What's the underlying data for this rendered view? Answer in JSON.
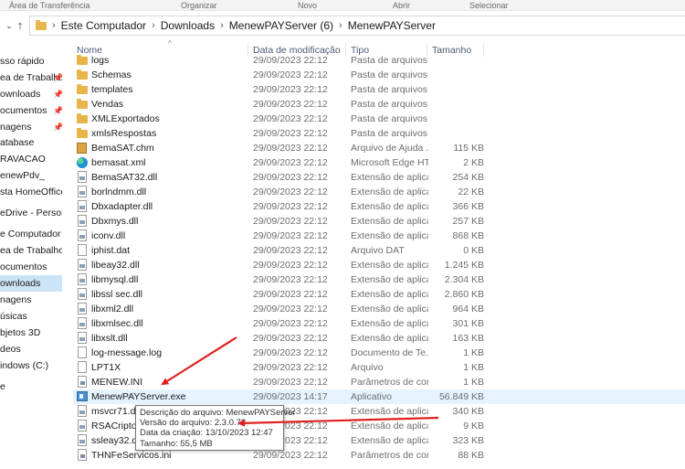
{
  "ribbon": {
    "groups": [
      "Área de Transferência",
      "Organizar",
      "Novo",
      "Abrir",
      "Selecionar"
    ]
  },
  "address": {
    "crumbs": [
      "Este Computador",
      "Downloads",
      "MenewPAYServer (6)",
      "MenewPAYServer"
    ]
  },
  "sidebar": {
    "items": [
      {
        "label": "sso rápido",
        "pinned": false
      },
      {
        "label": "ea de Trabalho",
        "pinned": true
      },
      {
        "label": "ownloads",
        "pinned": true
      },
      {
        "label": "ocumentos",
        "pinned": true
      },
      {
        "label": "nagens",
        "pinned": true
      },
      {
        "label": "atabase",
        "pinned": false
      },
      {
        "label": "RAVACAO",
        "pinned": false
      },
      {
        "label": "enewPdv_",
        "pinned": false
      },
      {
        "label": "sta HomeOffice",
        "pinned": false
      },
      {
        "label": "eDrive - Personal",
        "pinned": false
      },
      {
        "label": "e Computador",
        "pinned": false
      },
      {
        "label": "ea de Trabalho",
        "pinned": false
      },
      {
        "label": "ocumentos",
        "pinned": false
      },
      {
        "label": "ownloads",
        "pinned": false,
        "active": true
      },
      {
        "label": "nagens",
        "pinned": false
      },
      {
        "label": "úsicas",
        "pinned": false
      },
      {
        "label": "bjetos 3D",
        "pinned": false
      },
      {
        "label": "deos",
        "pinned": false
      },
      {
        "label": "indows (C:)",
        "pinned": false
      },
      {
        "label": "e",
        "pinned": false
      }
    ]
  },
  "columns": {
    "name": "Nome",
    "date": "Data de modificação",
    "type": "Tipo",
    "size": "Tamanho"
  },
  "files": [
    {
      "name": "logs",
      "date": "29/09/2023 22:12",
      "type": "Pasta de arquivos",
      "size": "",
      "icon": "folder-icon"
    },
    {
      "name": "Schemas",
      "date": "29/09/2023 22:12",
      "type": "Pasta de arquivos",
      "size": "",
      "icon": "folder-icon"
    },
    {
      "name": "templates",
      "date": "29/09/2023 22:12",
      "type": "Pasta de arquivos",
      "size": "",
      "icon": "folder-icon"
    },
    {
      "name": "Vendas",
      "date": "29/09/2023 22:12",
      "type": "Pasta de arquivos",
      "size": "",
      "icon": "folder-icon"
    },
    {
      "name": "XMLExportados",
      "date": "29/09/2023 22:12",
      "type": "Pasta de arquivos",
      "size": "",
      "icon": "folder-icon"
    },
    {
      "name": "xmlsRespostas",
      "date": "29/09/2023 22:12",
      "type": "Pasta de arquivos",
      "size": "",
      "icon": "folder-icon"
    },
    {
      "name": "BemaSAT.chm",
      "date": "29/09/2023 22:12",
      "type": "Arquivo de Ajuda ...",
      "size": "115 KB",
      "icon": "chm-icon"
    },
    {
      "name": "bemasat.xml",
      "date": "29/09/2023 22:12",
      "type": "Microsoft Edge HT...",
      "size": "2 KB",
      "icon": "edge-icon"
    },
    {
      "name": "BemaSAT32.dll",
      "date": "29/09/2023 22:12",
      "type": "Extensão de aplica...",
      "size": "254 KB",
      "icon": "dll-icon"
    },
    {
      "name": "borlndmm.dll",
      "date": "29/09/2023 22:12",
      "type": "Extensão de aplica...",
      "size": "22 KB",
      "icon": "dll-icon"
    },
    {
      "name": "Dbxadapter.dll",
      "date": "29/09/2023 22:12",
      "type": "Extensão de aplica...",
      "size": "366 KB",
      "icon": "dll-icon"
    },
    {
      "name": "Dbxmys.dll",
      "date": "29/09/2023 22:12",
      "type": "Extensão de aplica...",
      "size": "257 KB",
      "icon": "dll-icon"
    },
    {
      "name": "iconv.dll",
      "date": "29/09/2023 22:12",
      "type": "Extensão de aplica...",
      "size": "868 KB",
      "icon": "dll-icon"
    },
    {
      "name": "iphist.dat",
      "date": "29/09/2023 22:12",
      "type": "Arquivo DAT",
      "size": "0 KB",
      "icon": "document-icon"
    },
    {
      "name": "libeay32.dll",
      "date": "29/09/2023 22:12",
      "type": "Extensão de aplica...",
      "size": "1.245 KB",
      "icon": "dll-icon"
    },
    {
      "name": "libmysql.dll",
      "date": "29/09/2023 22:12",
      "type": "Extensão de aplica...",
      "size": "2.304 KB",
      "icon": "dll-icon"
    },
    {
      "name": "libssl sec.dll",
      "date": "29/09/2023 22:12",
      "type": "Extensão de aplica...",
      "size": "2.860 KB",
      "icon": "dll-icon"
    },
    {
      "name": "libxml2.dll",
      "date": "29/09/2023 22:12",
      "type": "Extensão de aplica...",
      "size": "964 KB",
      "icon": "dll-icon"
    },
    {
      "name": "libxmlsec.dll",
      "date": "29/09/2023 22:12",
      "type": "Extensão de aplica...",
      "size": "301 KB",
      "icon": "dll-icon"
    },
    {
      "name": "libxslt.dll",
      "date": "29/09/2023 22:12",
      "type": "Extensão de aplica...",
      "size": "163 KB",
      "icon": "dll-icon"
    },
    {
      "name": "log-message.log",
      "date": "29/09/2023 22:12",
      "type": "Documento de Te...",
      "size": "1 KB",
      "icon": "document-icon"
    },
    {
      "name": "LPT1X",
      "date": "29/09/2023 22:12",
      "type": "Arquivo",
      "size": "1 KB",
      "icon": "document-icon"
    },
    {
      "name": "MENEW.INI",
      "date": "29/09/2023 22:12",
      "type": "Parâmetros de con...",
      "size": "1 KB",
      "icon": "ini-icon"
    },
    {
      "name": "MenewPAYServer.exe",
      "date": "29/09/2023 14:17",
      "type": "Aplicativo",
      "size": "56.849 KB",
      "icon": "exe-icon",
      "selected": true
    },
    {
      "name": "msvcr71.dll",
      "date": "29/09/2023 22:12",
      "type": "Extensão de aplica...",
      "size": "340 KB",
      "icon": "dll-icon"
    },
    {
      "name": "RSACriptografia.dll",
      "date": "29/09/2023 22:12",
      "type": "Extensão de aplica...",
      "size": "9 KB",
      "icon": "dll-icon"
    },
    {
      "name": "ssleay32.dll",
      "date": "29/09/2023 22:12",
      "type": "Extensão de aplica...",
      "size": "323 KB",
      "icon": "dll-icon"
    },
    {
      "name": "THNFeServicos.ini",
      "date": "29/09/2023 22:12",
      "type": "Parâmetros de con...",
      "size": "88 KB",
      "icon": "ini-icon"
    }
  ],
  "tooltip": {
    "lines": [
      "Descrição do arquivo: MenewPAYServer",
      "Versão do arquivo: 2.3.0.78",
      "Data da criação: 13/10/2023 12:47",
      "Tamanho: 55,5 MB"
    ]
  },
  "colors": {
    "folder": "#e8b54a",
    "selection": "#e5f3ff",
    "active_nav": "#cce4f7",
    "annotation_arrow": "#e02020"
  }
}
